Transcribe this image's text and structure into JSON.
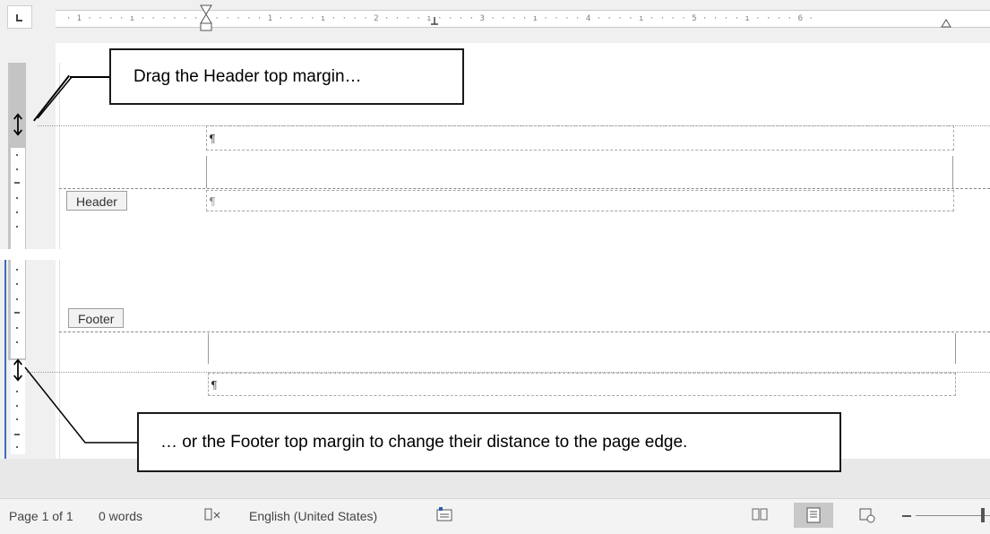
{
  "ruler": {
    "tab_stop_marker": "L",
    "tick_numbers": [
      "1",
      "1",
      "2",
      "3",
      "4",
      "5",
      "6"
    ]
  },
  "callouts": {
    "header_text": "Drag the Header top margin…",
    "footer_text": "… or the Footer top margin to change their distance to the page  edge."
  },
  "regions": {
    "header_label": "Header",
    "footer_label": "Footer",
    "paragraph_mark": "¶"
  },
  "status_bar": {
    "page": "Page 1 of 1",
    "words": "0 words",
    "language": "English (United States)"
  },
  "icons": {
    "proofing": "book-check-icon",
    "macro": "macro-recording-icon",
    "read_mode": "read-mode-icon",
    "print_layout": "print-layout-icon",
    "web_layout": "web-layout-icon",
    "margin_drag": "vertical-resize-arrow-icon"
  },
  "colors": {
    "ruler_bg": "#f0f0f0",
    "callout_border": "#1a1a1a",
    "status_bg": "#f3f3f3"
  }
}
